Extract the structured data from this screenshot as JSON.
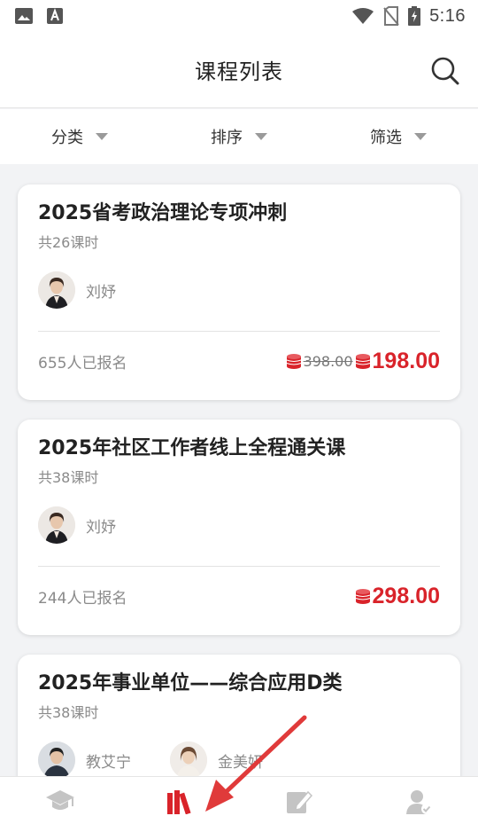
{
  "status_bar": {
    "time": "5:16",
    "left_icons": [
      "image-icon",
      "text-a-icon"
    ],
    "right_icons": [
      "wifi-icon",
      "no-sim-icon",
      "battery-charging-icon"
    ]
  },
  "header": {
    "title": "课程列表",
    "search_icon": "search-icon"
  },
  "filters": [
    {
      "label": "分类"
    },
    {
      "label": "排序"
    },
    {
      "label": "筛选"
    }
  ],
  "courses": [
    {
      "title": "2025省考政治理论专项冲刺",
      "lessons": "共26课时",
      "teachers": [
        {
          "name": "刘妤"
        }
      ],
      "enrolled": "655人已报名",
      "old_price": "398.00",
      "price": "198.00"
    },
    {
      "title": "2025年社区工作者线上全程通关课",
      "lessons": "共38课时",
      "teachers": [
        {
          "name": "刘妤"
        }
      ],
      "enrolled": "244人已报名",
      "price": "298.00"
    },
    {
      "title": "2025年事业单位——综合应用D类",
      "lessons": "共38课时",
      "teachers": [
        {
          "name": "教艾宁"
        },
        {
          "name": "金美妍"
        }
      ]
    }
  ],
  "tab_bar": {
    "tabs": [
      {
        "icon": "graduation-cap-icon",
        "active": false
      },
      {
        "icon": "books-icon",
        "active": true
      },
      {
        "icon": "edit-icon",
        "active": false
      },
      {
        "icon": "user-verified-icon",
        "active": false
      }
    ],
    "active_color": "#d9232a",
    "inactive_color": "#c4c4c4"
  },
  "colors": {
    "accent": "#d9232a",
    "annotation_arrow": "#e03a3a"
  }
}
